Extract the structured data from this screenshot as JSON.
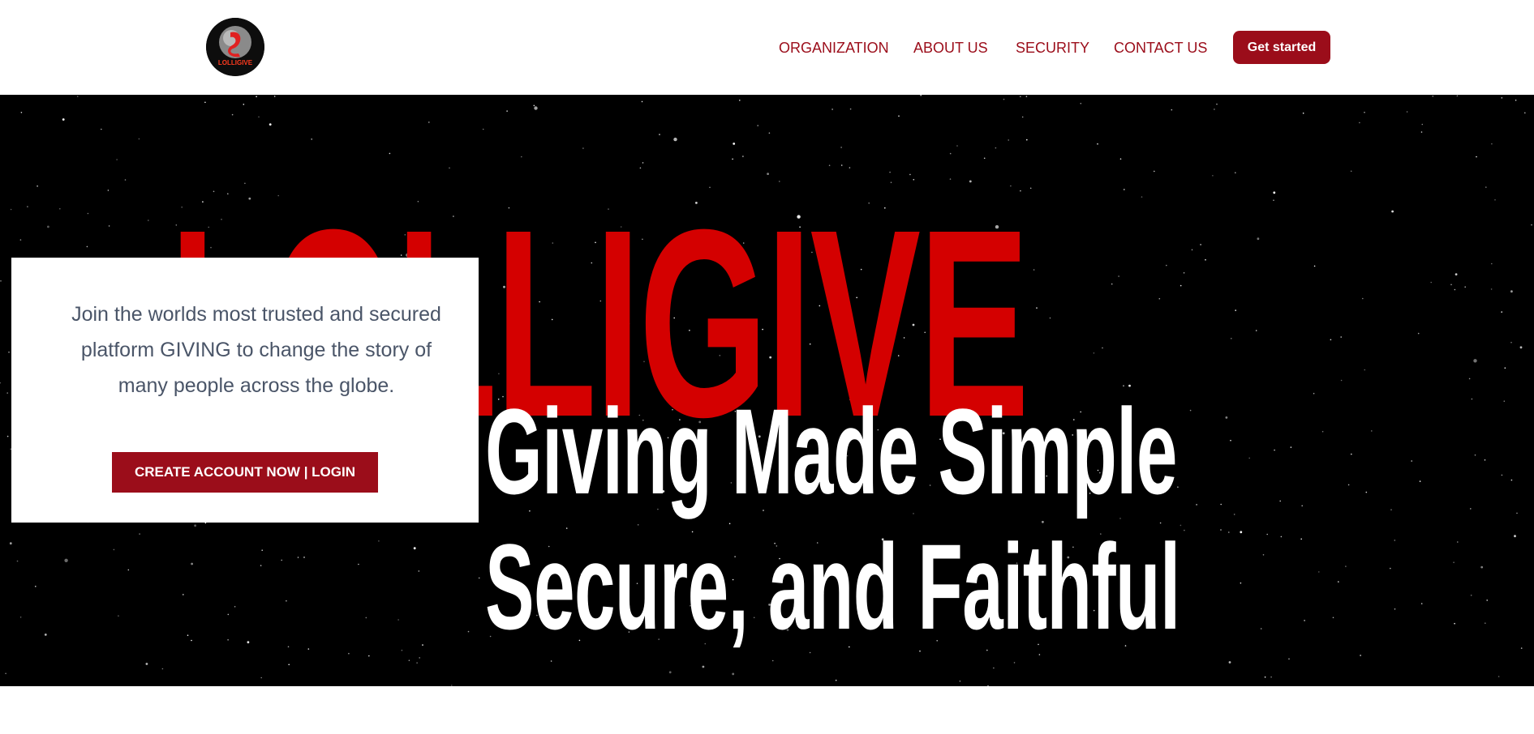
{
  "header": {
    "logo_text": "LOLLIGIVE",
    "nav": [
      "ORGANIZATION",
      "ABOUT US",
      "SECURITY",
      "CONTACT US"
    ],
    "cta_label": "Get started"
  },
  "hero": {
    "title": "LOLLIGIVE",
    "tagline_line1": "Giving Made Simple",
    "tagline_line2": "Secure, and Faithful",
    "card_text": "Join the worlds most trusted and secured platform GIVING to change the story of many people across the globe.",
    "card_button": "CREATE ACCOUNT NOW | LOGIN"
  },
  "colors": {
    "brand_red": "#9b0d1a",
    "title_red": "#d40000",
    "hero_bg": "#000000",
    "card_text": "#4a5568"
  }
}
